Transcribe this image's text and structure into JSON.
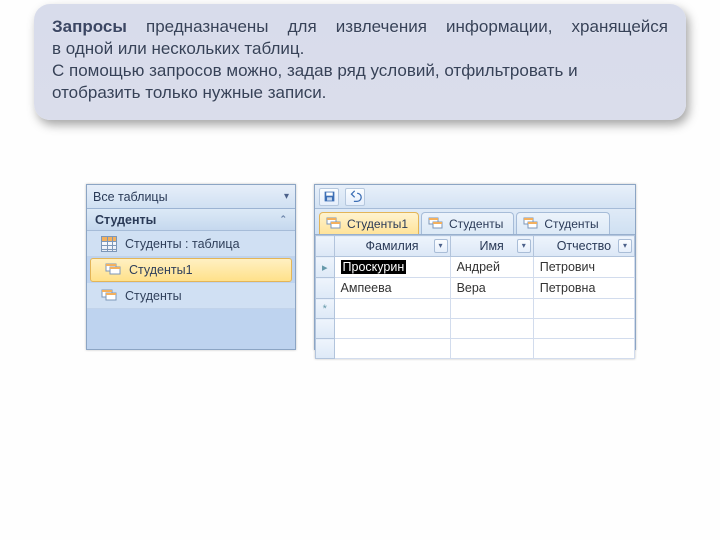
{
  "info": {
    "line1_bold": "Запросы",
    "line1_rest": "предназначены для извлечения информации, хранящейся",
    "line2": "в одной или нескольких таблиц.",
    "line3": "С помощью запросов можно, задав ряд условий, отфильтровать и отобразить только нужные записи."
  },
  "nav": {
    "header": "Все таблицы",
    "group": "Студенты",
    "items": [
      {
        "label": "Студенты : таблица",
        "type": "table"
      },
      {
        "label": "Студенты1",
        "type": "query",
        "selected": true
      },
      {
        "label": "Студенты",
        "type": "query"
      }
    ]
  },
  "sheet": {
    "tabs": [
      "Студенты1",
      "Студенты",
      "Студенты"
    ],
    "active_tab": 0,
    "columns": [
      "Фамилия",
      "Имя",
      "Отчество"
    ],
    "rows": [
      {
        "f": "Проскурин",
        "i": "Андрей",
        "o": "Петрович",
        "selected": true
      },
      {
        "f": "Ампеева",
        "i": "Вера",
        "o": "Петровна"
      }
    ]
  }
}
